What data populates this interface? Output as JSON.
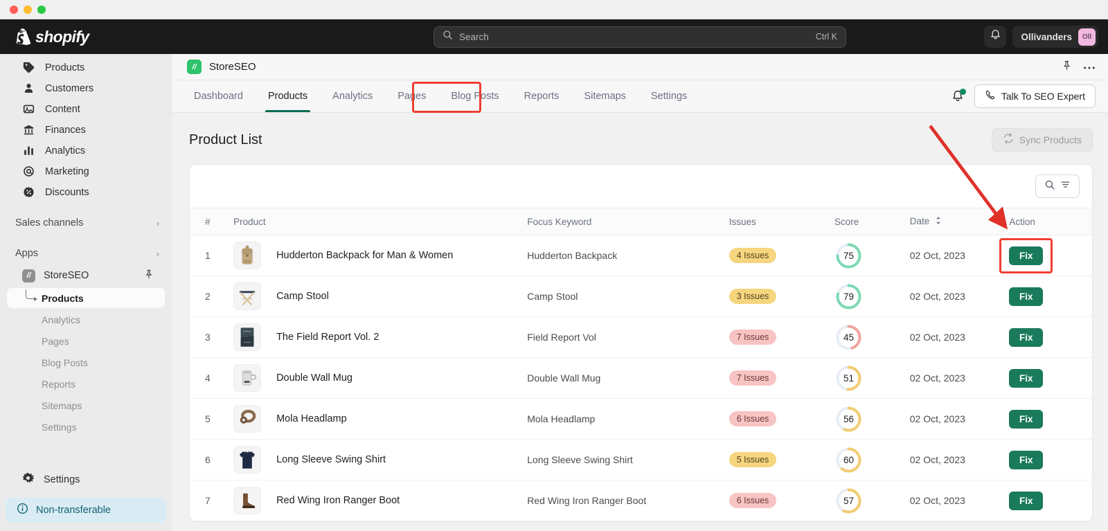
{
  "window": {
    "title": ""
  },
  "shopify_topbar": {
    "logo_text": "shopify",
    "search": {
      "placeholder": "Search",
      "shortcut": "Ctrl K",
      "icon": "search-icon"
    },
    "notifications_icon": "bell-icon",
    "user": {
      "name": "Ollivanders",
      "avatar_initials": "Oll",
      "avatar_color": "#f2b8e0"
    }
  },
  "sidebar": {
    "nav": [
      {
        "label": "Products",
        "icon": "tag-icon"
      },
      {
        "label": "Customers",
        "icon": "person-icon"
      },
      {
        "label": "Content",
        "icon": "image-icon"
      },
      {
        "label": "Finances",
        "icon": "bank-icon"
      },
      {
        "label": "Analytics",
        "icon": "bar-chart-icon"
      },
      {
        "label": "Marketing",
        "icon": "target-icon"
      },
      {
        "label": "Discounts",
        "icon": "discount-icon"
      }
    ],
    "sections": [
      {
        "label": "Sales channels",
        "icon": "chevron-right-icon"
      },
      {
        "label": "Apps",
        "icon": "chevron-right-icon"
      }
    ],
    "app": {
      "label": "StoreSEO",
      "badge_text": "//",
      "badge_color": "#8f8f8f",
      "pin_icon": "pin-icon"
    },
    "app_subitems": [
      {
        "label": "Products",
        "active": true
      },
      {
        "label": "Analytics",
        "active": false
      },
      {
        "label": "Pages",
        "active": false
      },
      {
        "label": "Blog Posts",
        "active": false
      },
      {
        "label": "Reports",
        "active": false
      },
      {
        "label": "Sitemaps",
        "active": false
      },
      {
        "label": "Settings",
        "active": false
      }
    ],
    "settings": {
      "label": "Settings",
      "icon": "gear-icon"
    },
    "footer_banner": {
      "label": "Non-transferable",
      "icon": "info-icon",
      "color": "#d9ecf5"
    }
  },
  "app_header": {
    "title": "StoreSEO",
    "badge_text": "//",
    "badge_color": "#2dc26b",
    "pin_icon": "pin-icon",
    "more_icon": "ellipsis-icon"
  },
  "tabs": [
    {
      "label": "Dashboard",
      "active": false
    },
    {
      "label": "Products",
      "active": true
    },
    {
      "label": "Analytics",
      "active": false
    },
    {
      "label": "Pages",
      "active": false
    },
    {
      "label": "Blog Posts",
      "active": false
    },
    {
      "label": "Reports",
      "active": false
    },
    {
      "label": "Sitemaps",
      "active": false
    },
    {
      "label": "Settings",
      "active": false
    }
  ],
  "tabs_right": {
    "notification_icon": "bell-icon",
    "expert_button": {
      "label": "Talk To SEO Expert",
      "icon": "phone-icon"
    }
  },
  "page": {
    "title": "Product List",
    "sync_button": {
      "label": "Sync Products",
      "icon": "sync-icon",
      "disabled": true
    },
    "filter_button": {
      "search_icon": "search-icon",
      "filter_icon": "filter-icon"
    }
  },
  "table": {
    "columns": [
      "#",
      "Product",
      "Focus Keyword",
      "Issues",
      "Score",
      "Date",
      "Action"
    ],
    "date_sort_icon": "sort-icon",
    "action_label": "Fix",
    "rows": [
      {
        "num": "1",
        "product": "Hudderton Backpack for Man & Women",
        "keyword": "Hudderton Backpack",
        "issues": "4 Issues",
        "issues_level": "warn",
        "score": 75,
        "score_color": "#7ed9b4",
        "date": "02 Oct, 2023",
        "action": "Fix",
        "thumb": "backpack"
      },
      {
        "num": "2",
        "product": "Camp Stool",
        "keyword": "Camp Stool",
        "issues": "3 Issues",
        "issues_level": "warn",
        "score": 79,
        "score_color": "#7ed9b4",
        "date": "02 Oct, 2023",
        "action": "Fix",
        "thumb": "stool"
      },
      {
        "num": "3",
        "product": "The Field Report Vol. 2",
        "keyword": "Field Report Vol",
        "issues": "7 Issues",
        "issues_level": "err",
        "score": 45,
        "score_color": "#f2a5a0",
        "date": "02 Oct, 2023",
        "action": "Fix",
        "thumb": "book"
      },
      {
        "num": "4",
        "product": "Double Wall Mug",
        "keyword": "Double Wall Mug",
        "issues": "7 Issues",
        "issues_level": "err",
        "score": 51,
        "score_color": "#f2cc72",
        "date": "02 Oct, 2023",
        "action": "Fix",
        "thumb": "mug"
      },
      {
        "num": "5",
        "product": "Mola Headlamp",
        "keyword": "Mola Headlamp",
        "issues": "6 Issues",
        "issues_level": "err",
        "score": 56,
        "score_color": "#f2cc72",
        "date": "02 Oct, 2023",
        "action": "Fix",
        "thumb": "headlamp"
      },
      {
        "num": "6",
        "product": "Long Sleeve Swing Shirt",
        "keyword": "Long Sleeve Swing Shirt",
        "issues": "5 Issues",
        "issues_level": "warn",
        "score": 60,
        "score_color": "#f2cc72",
        "date": "02 Oct, 2023",
        "action": "Fix",
        "thumb": "shirt"
      },
      {
        "num": "7",
        "product": "Red Wing Iron Ranger Boot",
        "keyword": "Red Wing Iron Ranger Boot",
        "issues": "6 Issues",
        "issues_level": "err",
        "score": 57,
        "score_color": "#f2cc72",
        "date": "02 Oct, 2023",
        "action": "Fix",
        "thumb": "boot"
      }
    ]
  },
  "annotations": {
    "arrow_color": "#e03128",
    "highlight_color": "#ef3e33"
  }
}
